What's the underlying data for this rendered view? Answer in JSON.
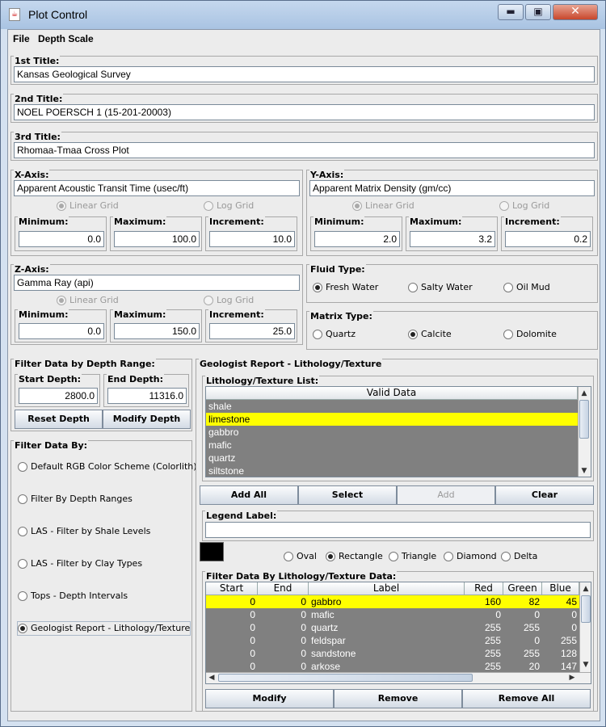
{
  "window": {
    "title": "Plot Control",
    "app_icon": "java-icon"
  },
  "menu": [
    "File",
    "Depth Scale"
  ],
  "titles": [
    {
      "label": "1st Title:",
      "value": "Kansas Geological Survey"
    },
    {
      "label": "2nd Title:",
      "value": "NOEL POERSCH 1 (15-201-20003)"
    },
    {
      "label": "3rd Title:",
      "value": "Rhomaa-Tmaa Cross Plot"
    }
  ],
  "xaxis": {
    "label": "X-Axis:",
    "title": "Apparent Acoustic Transit Time (usec/ft)",
    "linear": "Linear Grid",
    "log": "Log Grid",
    "min_label": "Minimum:",
    "min": "0.0",
    "max_label": "Maximum:",
    "max": "100.0",
    "inc_label": "Increment:",
    "inc": "10.0"
  },
  "yaxis": {
    "label": "Y-Axis:",
    "title": "Apparent Matrix Density (gm/cc)",
    "linear": "Linear Grid",
    "log": "Log Grid",
    "min_label": "Minimum:",
    "min": "2.0",
    "max_label": "Maximum:",
    "max": "3.2",
    "inc_label": "Increment:",
    "inc": "0.2"
  },
  "zaxis": {
    "label": "Z-Axis:",
    "title": "Gamma Ray (api)",
    "linear": "Linear Grid",
    "log": "Log Grid",
    "min_label": "Minimum:",
    "min": "0.0",
    "max_label": "Maximum:",
    "max": "150.0",
    "inc_label": "Increment:",
    "inc": "25.0"
  },
  "fluid": {
    "label": "Fluid Type:",
    "options": [
      "Fresh Water",
      "Salty Water",
      "Oil Mud"
    ],
    "selected": "Fresh Water"
  },
  "matrix": {
    "label": "Matrix Type:",
    "options": [
      "Quartz",
      "Calcite",
      "Dolomite"
    ],
    "selected": "Calcite"
  },
  "depth_range": {
    "label": "Filter Data by Depth Range:",
    "start_label": "Start Depth:",
    "start": "2800.0",
    "end_label": "End Depth:",
    "end": "11316.0",
    "reset": "Reset Depth",
    "modify": "Modify Depth"
  },
  "filter_by": {
    "label": "Filter Data By:",
    "options": [
      "Default RGB Color Scheme (Colorlith)",
      "Filter By Depth Ranges",
      "LAS - Filter by Shale Levels",
      "LAS - Filter by Clay Types",
      "Tops - Depth Intervals",
      "Geologist Report - Lithology/Texture"
    ],
    "selected": "Geologist Report - Lithology/Texture"
  },
  "geo": {
    "label": "Geologist Report - Lithology/Texture",
    "list_label": "Lithology/Texture List:",
    "list_header": "Valid Data",
    "list_items": [
      "shale",
      "limestone",
      "gabbro",
      "mafic",
      "quartz",
      "siltstone"
    ],
    "list_selected": "limestone",
    "buttons": [
      "Add All",
      "Select",
      "Add",
      "Clear"
    ],
    "legend_label": "Legend Label:",
    "legend_value": "",
    "swatch_color": "#000000",
    "shapes": [
      "Oval",
      "Rectangle",
      "Triangle",
      "Diamond",
      "Delta"
    ],
    "shape_selected": "Rectangle",
    "filter_label": "Filter Data By Lithology/Texture Data:",
    "columns": [
      "Start",
      "End",
      "Label",
      "Red",
      "Green",
      "Blue"
    ],
    "rows": [
      [
        "0",
        "0",
        "gabbro",
        "160",
        "82",
        "45"
      ],
      [
        "0",
        "0",
        "mafic",
        "0",
        "0",
        "0"
      ],
      [
        "0",
        "0",
        "quartz",
        "255",
        "255",
        "0"
      ],
      [
        "0",
        "0",
        "feldspar",
        "255",
        "0",
        "255"
      ],
      [
        "0",
        "0",
        "sandstone",
        "255",
        "255",
        "128"
      ],
      [
        "0",
        "0",
        "arkose",
        "255",
        "20",
        "147"
      ]
    ],
    "bottom_buttons": [
      "Modify",
      "Remove",
      "Remove All"
    ]
  },
  "colors": {
    "highlight": "#ffff00",
    "table_bg": "#808080"
  }
}
